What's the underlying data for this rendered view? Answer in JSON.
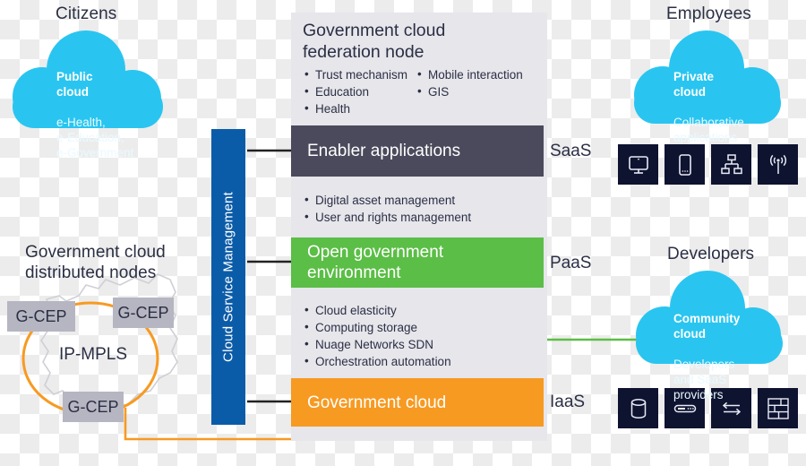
{
  "colors": {
    "cloud_cyan": "#29c5f0",
    "saas_band": "#4a4a5c",
    "paas_band": "#5bbe46",
    "iaas_band": "#f79a22",
    "csm_blue": "#0b5ca8",
    "panel_gray": "#e6e6eb",
    "gcep_gray": "#b6b6c2",
    "tile_navy": "#0e1330",
    "text_dark": "#2b2f44"
  },
  "sections": {
    "citizens": "Citizens",
    "employees": "Employees",
    "developers": "Developers",
    "distributed_nodes": "Government cloud\ndistributed nodes"
  },
  "clouds": {
    "public": {
      "title": "Public\ncloud",
      "subtitle": "e-Health,\ne-Education,\ne-Government"
    },
    "private": {
      "title": "Private\ncloud",
      "subtitle": "Collaborative\napplications"
    },
    "community": {
      "title": "Community\ncloud",
      "subtitle": "Developers\nand SaaS\nproviders"
    }
  },
  "center": {
    "panel_title": "Government cloud\nfederation node",
    "header_bullets_left": [
      "Trust mechanism",
      "Education",
      "Health"
    ],
    "header_bullets_right": [
      "Mobile interaction",
      "GIS"
    ],
    "bands": {
      "saas": {
        "label": "Enabler applications",
        "tier": "SaaS"
      },
      "paas": {
        "label": "Open government\nenvironment",
        "tier": "PaaS"
      },
      "iaas": {
        "label": "Government cloud",
        "tier": "IaaS"
      }
    },
    "saas_bullets": [
      "Digital asset management",
      "User and rights management"
    ],
    "paas_bullets": [
      "Cloud elasticity",
      "Computing storage",
      "Nuage Networks SDN",
      "Orchestration automation"
    ]
  },
  "csm_bar": {
    "label": "Cloud Service Management"
  },
  "network": {
    "nodes": [
      "G-CEP",
      "G-CEP",
      "G-CEP"
    ],
    "ring_label": "IP-MPLS"
  },
  "tiles": {
    "employees": [
      "monitor-icon",
      "tablet-icon",
      "network-topology-icon",
      "antenna-icon"
    ],
    "infrastructure": [
      "database-icon",
      "server-icon",
      "bidirectional-arrows-icon",
      "storage-grid-icon"
    ]
  }
}
